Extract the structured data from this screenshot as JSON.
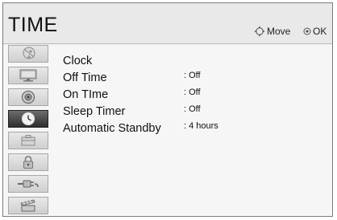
{
  "header": {
    "title": "TIME",
    "move_hint": "Move",
    "ok_hint": "OK"
  },
  "sidebar": {
    "items": [
      {
        "icon": "satellite-icon",
        "active": false
      },
      {
        "icon": "monitor-icon",
        "active": false
      },
      {
        "icon": "speaker-icon",
        "active": false
      },
      {
        "icon": "clock-icon",
        "active": true
      },
      {
        "icon": "toolbox-icon",
        "active": false
      },
      {
        "icon": "lock-icon",
        "active": false
      },
      {
        "icon": "cable-icon",
        "active": false
      },
      {
        "icon": "film-icon",
        "active": false
      }
    ]
  },
  "menu": {
    "items": [
      {
        "label": "Clock",
        "value": ""
      },
      {
        "label": "Off Time",
        "value": ": Off"
      },
      {
        "label": "On TIme",
        "value": ": Off"
      },
      {
        "label": "Sleep Timer",
        "value": ": Off"
      },
      {
        "label": "Automatic Standby",
        "value": ": 4 hours"
      }
    ]
  },
  "colors": {
    "header_bg": "#e9e9e9",
    "panel_bg": "#f6f6f6",
    "active_tab": "#3a3a3a"
  }
}
